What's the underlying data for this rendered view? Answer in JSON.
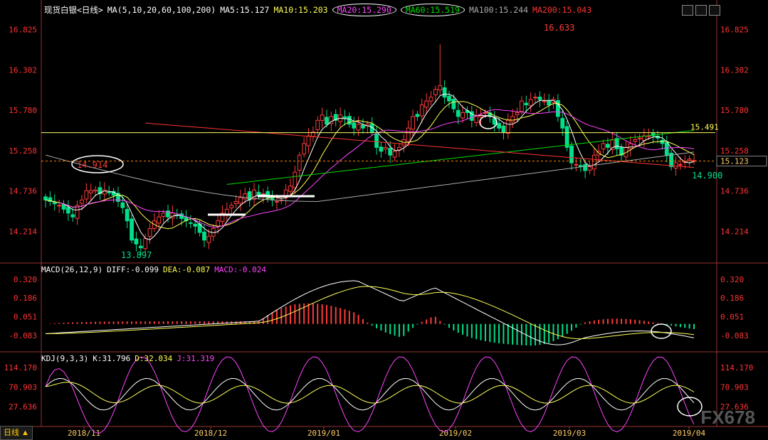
{
  "header": {
    "instrument": "现货白银",
    "period": "<日线>",
    "ma_def": "MA(5,10,20,60,100,200)",
    "ma5": "MA5:15.127",
    "ma10": "MA10:15.203",
    "ma20": "MA20:15.290",
    "ma60": "MA60:15.519",
    "ma100": "MA100:15.244",
    "ma200": "MA200:15.043"
  },
  "macd_header": {
    "def": "MACD(26,12,9)",
    "diff": "DIFF:-0.099",
    "dea": "DEA:-0.087",
    "macd": "MACD:-0.024"
  },
  "kdj_header": {
    "def": "KDJ(9,3,3)",
    "k": "K:31.796",
    "d": "D:32.034",
    "j": "J:31.319"
  },
  "tab_label": "日线 ▲",
  "watermark": "FX678",
  "colors": {
    "up": "#ff3b3b",
    "down": "#00e08a",
    "ma5": "#ffffff",
    "ma10": "#ffff55",
    "ma20": "#ff44ff",
    "ma60": "#00dd00",
    "ma100": "#aaaaaa",
    "ma200": "#ff3333",
    "axis": "#ff3333"
  },
  "chart_data": [
    {
      "type": "candlestick",
      "title": "现货白银",
      "y_ticks": [
        "16.825",
        "16.302",
        "15.780",
        "15.258",
        "14.736",
        "14.214"
      ],
      "ylim": [
        13.85,
        16.95
      ],
      "x_ticks": [
        "2018/11",
        "2018/12",
        "2019/01",
        "2019/02",
        "2019/03",
        "2019/04"
      ],
      "annotations": {
        "high": "16.633",
        "low": "13.897",
        "left_mark": "14.914",
        "hline_label": "15.491",
        "last_label": "15.123",
        "right_low": "14.900"
      },
      "hline_value": 15.491,
      "last_price": 15.123,
      "close": [
        14.62,
        14.6,
        14.57,
        14.55,
        14.5,
        14.45,
        14.4,
        14.55,
        14.62,
        14.74,
        14.74,
        14.75,
        14.7,
        14.75,
        14.72,
        14.68,
        14.6,
        14.52,
        14.35,
        14.1,
        14.05,
        14.0,
        14.12,
        14.25,
        14.35,
        14.4,
        14.45,
        14.4,
        14.45,
        14.42,
        14.38,
        14.35,
        14.32,
        14.28,
        14.2,
        14.1,
        14.15,
        14.25,
        14.35,
        14.45,
        14.5,
        14.55,
        14.6,
        14.65,
        14.7,
        14.62,
        14.75,
        14.68,
        14.7,
        14.65,
        14.62,
        14.6,
        14.62,
        14.75,
        14.8,
        14.98,
        15.2,
        15.35,
        15.45,
        15.5,
        15.65,
        15.72,
        15.6,
        15.7,
        15.65,
        15.72,
        15.68,
        15.6,
        15.55,
        15.6,
        15.55,
        15.6,
        15.5,
        15.3,
        15.25,
        15.3,
        15.2,
        15.25,
        15.3,
        15.4,
        15.55,
        15.7,
        15.7,
        15.85,
        15.9,
        15.95,
        16.05,
        16.1,
        15.95,
        15.9,
        15.8,
        15.7,
        15.75,
        15.75,
        15.65,
        15.7,
        15.72,
        15.75,
        15.7,
        15.6,
        15.55,
        15.5,
        15.65,
        15.7,
        15.75,
        15.9,
        15.85,
        15.92,
        15.95,
        15.92,
        15.9,
        15.85,
        15.92,
        15.7,
        15.55,
        15.3,
        15.1,
        15.08,
        15.05,
        15.0,
        15.05,
        15.2,
        15.25,
        15.35,
        15.3,
        15.4,
        15.28,
        15.2,
        15.3,
        15.35,
        15.4,
        15.42,
        15.45,
        15.45,
        15.45,
        15.42,
        15.35,
        15.2,
        15.05,
        15.1,
        15.08,
        15.12,
        15.15,
        15.13
      ]
    },
    {
      "type": "bar",
      "title": "MACD(26,12,9)",
      "y_ticks": [
        "0.320",
        "0.186",
        "0.051",
        "-0.083"
      ],
      "ylim": [
        -0.19,
        0.36
      ],
      "diff": -0.099,
      "dea": -0.087,
      "macd": -0.024
    },
    {
      "type": "line",
      "title": "KDJ(9,3,3)",
      "y_ticks": [
        "114.170",
        "70.903",
        "27.636"
      ],
      "ylim": [
        -10,
        125
      ],
      "k": 31.796,
      "d": 32.034,
      "j": 31.319
    }
  ]
}
